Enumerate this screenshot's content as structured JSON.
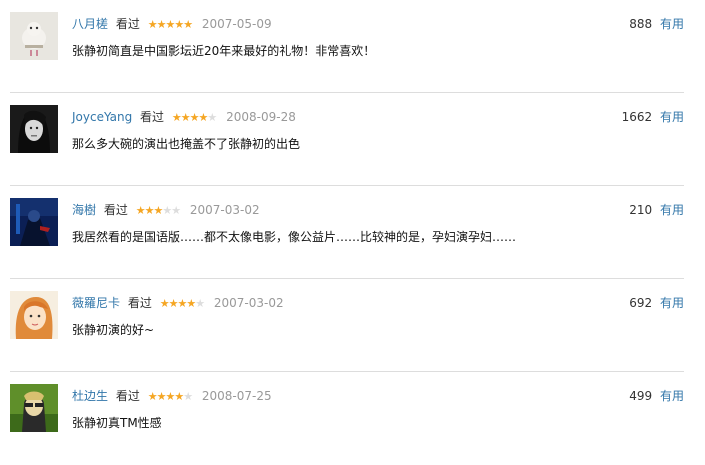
{
  "comments": [
    {
      "user": "八月槎",
      "status": "看过",
      "rating": 5,
      "date": "2007-05-09",
      "text": "张静初简直是中国影坛近20年来最好的礼物！非常喜欢！",
      "votes": "888",
      "useful_label": "有用"
    },
    {
      "user": "JoyceYang",
      "status": "看过",
      "rating": 4,
      "date": "2008-09-28",
      "text": "那么多大碗的演出也掩盖不了张静初的出色",
      "votes": "1662",
      "useful_label": "有用"
    },
    {
      "user": "海樹",
      "status": "看过",
      "rating": 3,
      "date": "2007-03-02",
      "text": "我居然看的是国语版……都不太像电影，像公益片……比较神的是，孕妇演孕妇……",
      "votes": "210",
      "useful_label": "有用"
    },
    {
      "user": "薇羅尼卡",
      "status": "看过",
      "rating": 4,
      "date": "2007-03-02",
      "text": "张静初演的好~",
      "votes": "692",
      "useful_label": "有用"
    },
    {
      "user": "杜边生",
      "status": "看过",
      "rating": 4,
      "date": "2008-07-25",
      "text": "张静初真TM性感",
      "votes": "499",
      "useful_label": "有用"
    }
  ],
  "colors": {
    "link": "#3377aa",
    "star": "#f5a623",
    "date": "#999999",
    "divider": "#dddddd"
  }
}
